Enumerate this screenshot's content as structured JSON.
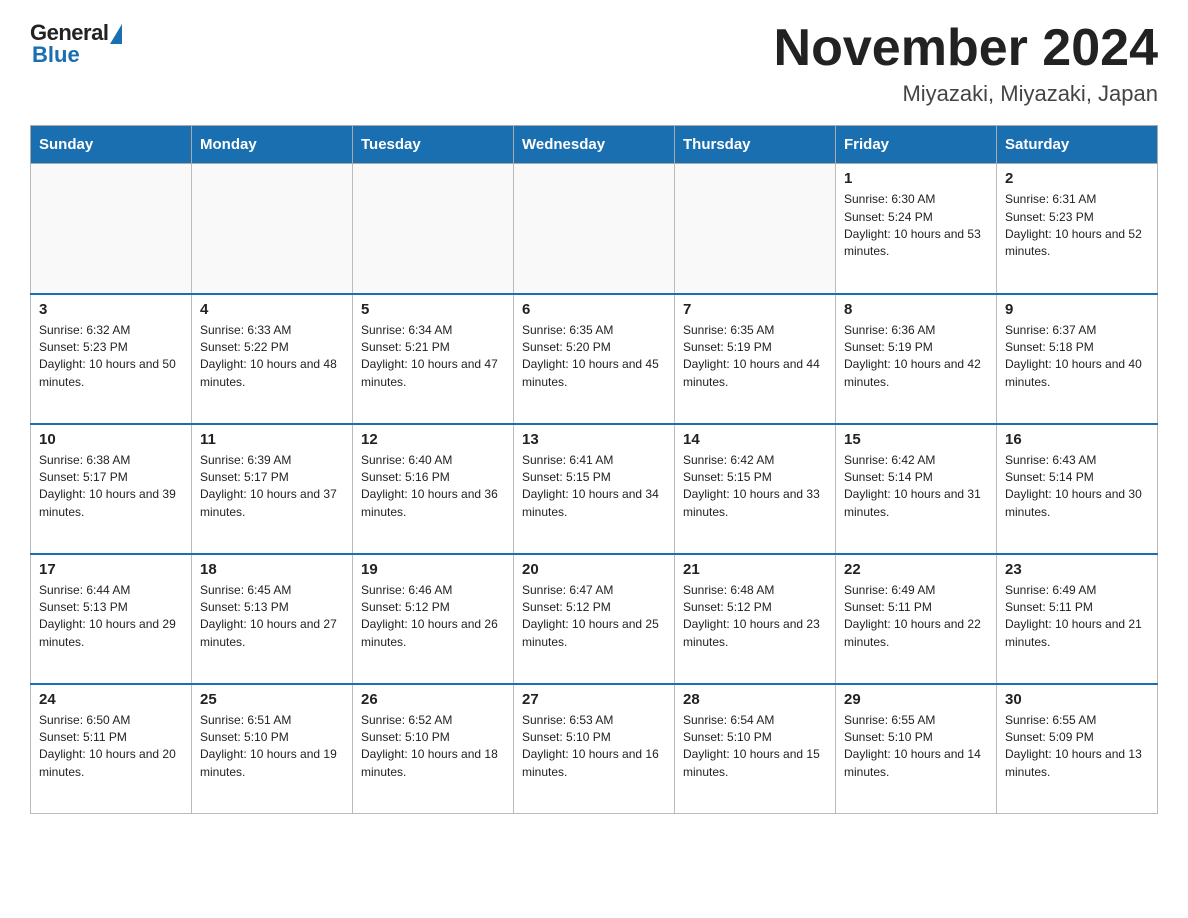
{
  "header": {
    "logo_general": "General",
    "logo_blue": "Blue",
    "month_title": "November 2024",
    "subtitle": "Miyazaki, Miyazaki, Japan"
  },
  "days_of_week": [
    "Sunday",
    "Monday",
    "Tuesday",
    "Wednesday",
    "Thursday",
    "Friday",
    "Saturday"
  ],
  "weeks": [
    [
      {
        "day": "",
        "info": ""
      },
      {
        "day": "",
        "info": ""
      },
      {
        "day": "",
        "info": ""
      },
      {
        "day": "",
        "info": ""
      },
      {
        "day": "",
        "info": ""
      },
      {
        "day": "1",
        "info": "Sunrise: 6:30 AM\nSunset: 5:24 PM\nDaylight: 10 hours and 53 minutes."
      },
      {
        "day": "2",
        "info": "Sunrise: 6:31 AM\nSunset: 5:23 PM\nDaylight: 10 hours and 52 minutes."
      }
    ],
    [
      {
        "day": "3",
        "info": "Sunrise: 6:32 AM\nSunset: 5:23 PM\nDaylight: 10 hours and 50 minutes."
      },
      {
        "day": "4",
        "info": "Sunrise: 6:33 AM\nSunset: 5:22 PM\nDaylight: 10 hours and 48 minutes."
      },
      {
        "day": "5",
        "info": "Sunrise: 6:34 AM\nSunset: 5:21 PM\nDaylight: 10 hours and 47 minutes."
      },
      {
        "day": "6",
        "info": "Sunrise: 6:35 AM\nSunset: 5:20 PM\nDaylight: 10 hours and 45 minutes."
      },
      {
        "day": "7",
        "info": "Sunrise: 6:35 AM\nSunset: 5:19 PM\nDaylight: 10 hours and 44 minutes."
      },
      {
        "day": "8",
        "info": "Sunrise: 6:36 AM\nSunset: 5:19 PM\nDaylight: 10 hours and 42 minutes."
      },
      {
        "day": "9",
        "info": "Sunrise: 6:37 AM\nSunset: 5:18 PM\nDaylight: 10 hours and 40 minutes."
      }
    ],
    [
      {
        "day": "10",
        "info": "Sunrise: 6:38 AM\nSunset: 5:17 PM\nDaylight: 10 hours and 39 minutes."
      },
      {
        "day": "11",
        "info": "Sunrise: 6:39 AM\nSunset: 5:17 PM\nDaylight: 10 hours and 37 minutes."
      },
      {
        "day": "12",
        "info": "Sunrise: 6:40 AM\nSunset: 5:16 PM\nDaylight: 10 hours and 36 minutes."
      },
      {
        "day": "13",
        "info": "Sunrise: 6:41 AM\nSunset: 5:15 PM\nDaylight: 10 hours and 34 minutes."
      },
      {
        "day": "14",
        "info": "Sunrise: 6:42 AM\nSunset: 5:15 PM\nDaylight: 10 hours and 33 minutes."
      },
      {
        "day": "15",
        "info": "Sunrise: 6:42 AM\nSunset: 5:14 PM\nDaylight: 10 hours and 31 minutes."
      },
      {
        "day": "16",
        "info": "Sunrise: 6:43 AM\nSunset: 5:14 PM\nDaylight: 10 hours and 30 minutes."
      }
    ],
    [
      {
        "day": "17",
        "info": "Sunrise: 6:44 AM\nSunset: 5:13 PM\nDaylight: 10 hours and 29 minutes."
      },
      {
        "day": "18",
        "info": "Sunrise: 6:45 AM\nSunset: 5:13 PM\nDaylight: 10 hours and 27 minutes."
      },
      {
        "day": "19",
        "info": "Sunrise: 6:46 AM\nSunset: 5:12 PM\nDaylight: 10 hours and 26 minutes."
      },
      {
        "day": "20",
        "info": "Sunrise: 6:47 AM\nSunset: 5:12 PM\nDaylight: 10 hours and 25 minutes."
      },
      {
        "day": "21",
        "info": "Sunrise: 6:48 AM\nSunset: 5:12 PM\nDaylight: 10 hours and 23 minutes."
      },
      {
        "day": "22",
        "info": "Sunrise: 6:49 AM\nSunset: 5:11 PM\nDaylight: 10 hours and 22 minutes."
      },
      {
        "day": "23",
        "info": "Sunrise: 6:49 AM\nSunset: 5:11 PM\nDaylight: 10 hours and 21 minutes."
      }
    ],
    [
      {
        "day": "24",
        "info": "Sunrise: 6:50 AM\nSunset: 5:11 PM\nDaylight: 10 hours and 20 minutes."
      },
      {
        "day": "25",
        "info": "Sunrise: 6:51 AM\nSunset: 5:10 PM\nDaylight: 10 hours and 19 minutes."
      },
      {
        "day": "26",
        "info": "Sunrise: 6:52 AM\nSunset: 5:10 PM\nDaylight: 10 hours and 18 minutes."
      },
      {
        "day": "27",
        "info": "Sunrise: 6:53 AM\nSunset: 5:10 PM\nDaylight: 10 hours and 16 minutes."
      },
      {
        "day": "28",
        "info": "Sunrise: 6:54 AM\nSunset: 5:10 PM\nDaylight: 10 hours and 15 minutes."
      },
      {
        "day": "29",
        "info": "Sunrise: 6:55 AM\nSunset: 5:10 PM\nDaylight: 10 hours and 14 minutes."
      },
      {
        "day": "30",
        "info": "Sunrise: 6:55 AM\nSunset: 5:09 PM\nDaylight: 10 hours and 13 minutes."
      }
    ]
  ]
}
